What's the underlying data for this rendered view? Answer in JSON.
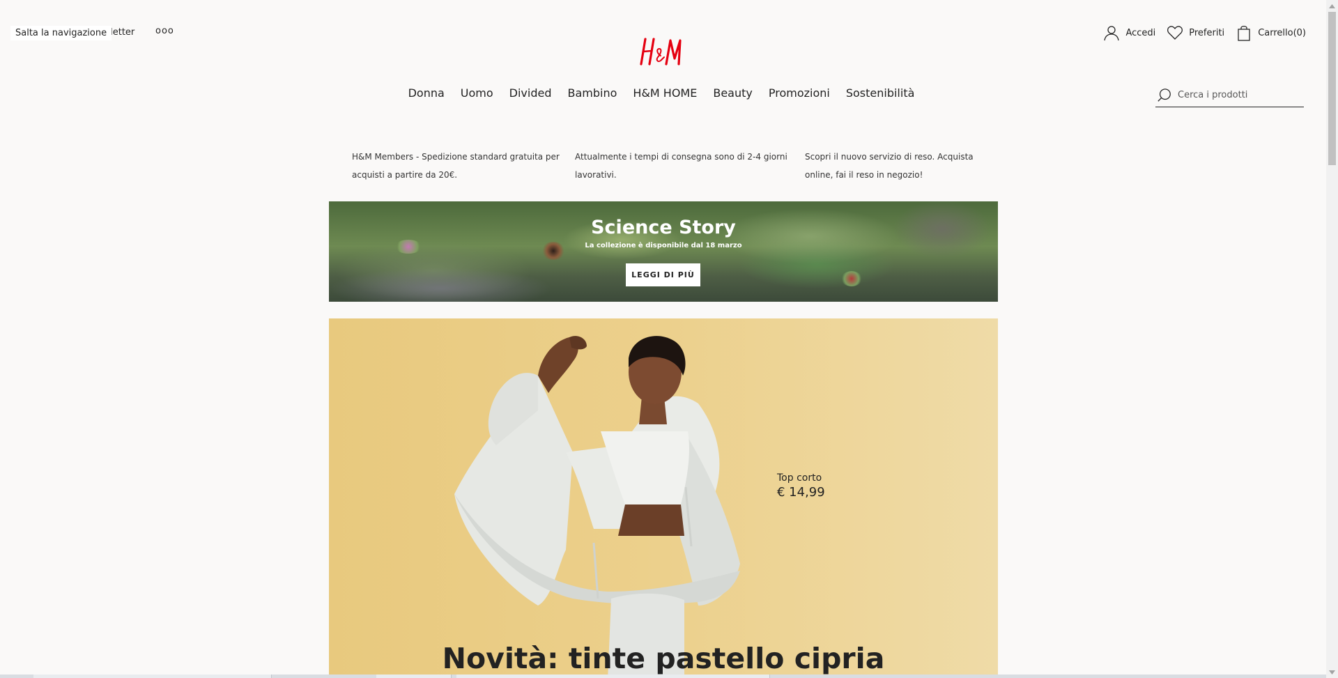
{
  "topbar": {
    "skip_link": "Salta la navigazione",
    "newsletter": "Newsletter",
    "more": "ooo"
  },
  "logo": {
    "alt": "H&M",
    "color": "#e50010"
  },
  "account": {
    "login": "Accedi",
    "favorites": "Preferiti",
    "cart": "Carrello(0)"
  },
  "nav": {
    "items": [
      "Donna",
      "Uomo",
      "Divided",
      "Bambino",
      "H&M HOME",
      "Beauty",
      "Promozioni",
      "Sostenibilità"
    ]
  },
  "search": {
    "placeholder": "Cerca i prodotti"
  },
  "info": {
    "members": "H&M Members - Spedizione standard gratuita per acquisti a partire da 20€.",
    "delivery": "Attualmente i tempi di consegna sono di 2-4 giorni lavorativi.",
    "returns": "Scopri il nuovo servizio di reso. Acquista online, fai il reso in negozio!"
  },
  "banner": {
    "title": "Science Story",
    "subtitle": "La collezione è disponibile dal 18 marzo",
    "button": "LEGGI DI PIÙ"
  },
  "hero": {
    "product_name": "Top corto",
    "product_price": "€ 14,99",
    "headline": "Novità: tinte pastello cipria"
  }
}
